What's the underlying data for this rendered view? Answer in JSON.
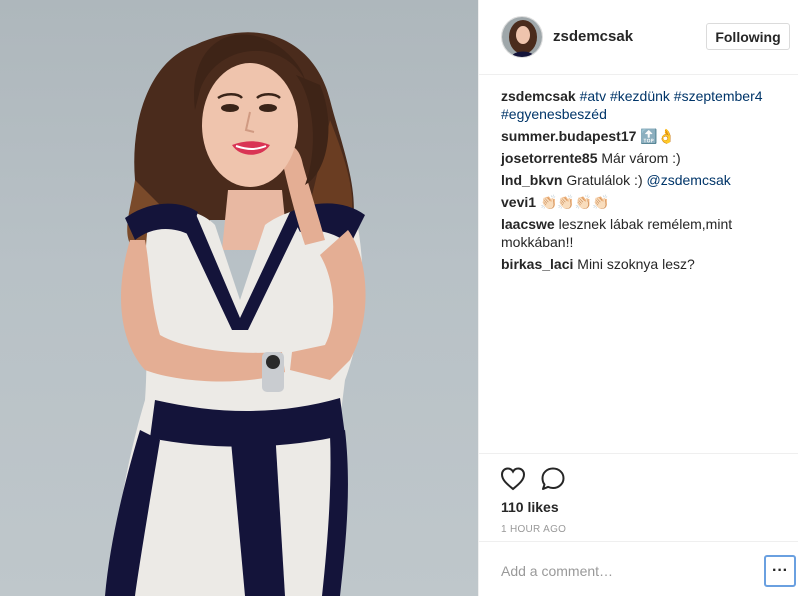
{
  "post": {
    "author": "zsdemcsak",
    "follow_label": "Following",
    "caption": {
      "user": "zsdemcsak",
      "tags": [
        "#atv",
        "#kezdünk",
        "#szeptember4",
        "#egyenesbeszéd"
      ]
    },
    "comments": [
      {
        "user": "summer.budapest17",
        "text": "🔝👌"
      },
      {
        "user": "josetorrente85",
        "text": "Már várom :)"
      },
      {
        "user": "lnd_bkvn",
        "text": "Gratulálok :) ",
        "mention": "@zsdemcsak"
      },
      {
        "user": "vevi1",
        "text": "👏🏻👏🏻👏🏻👏🏻"
      },
      {
        "user": "laacswe",
        "text": "lesznek lábak remélem,mint mokkában!!"
      },
      {
        "user": "birkas_laci",
        "text": "Mini szoknya lesz?"
      }
    ],
    "likes": "110 likes",
    "time": "1 HOUR AGO",
    "comment_placeholder": "Add a comment…",
    "more_label": "···",
    "icons": [
      "heart-icon",
      "comment-icon",
      "more-options-icon"
    ]
  }
}
